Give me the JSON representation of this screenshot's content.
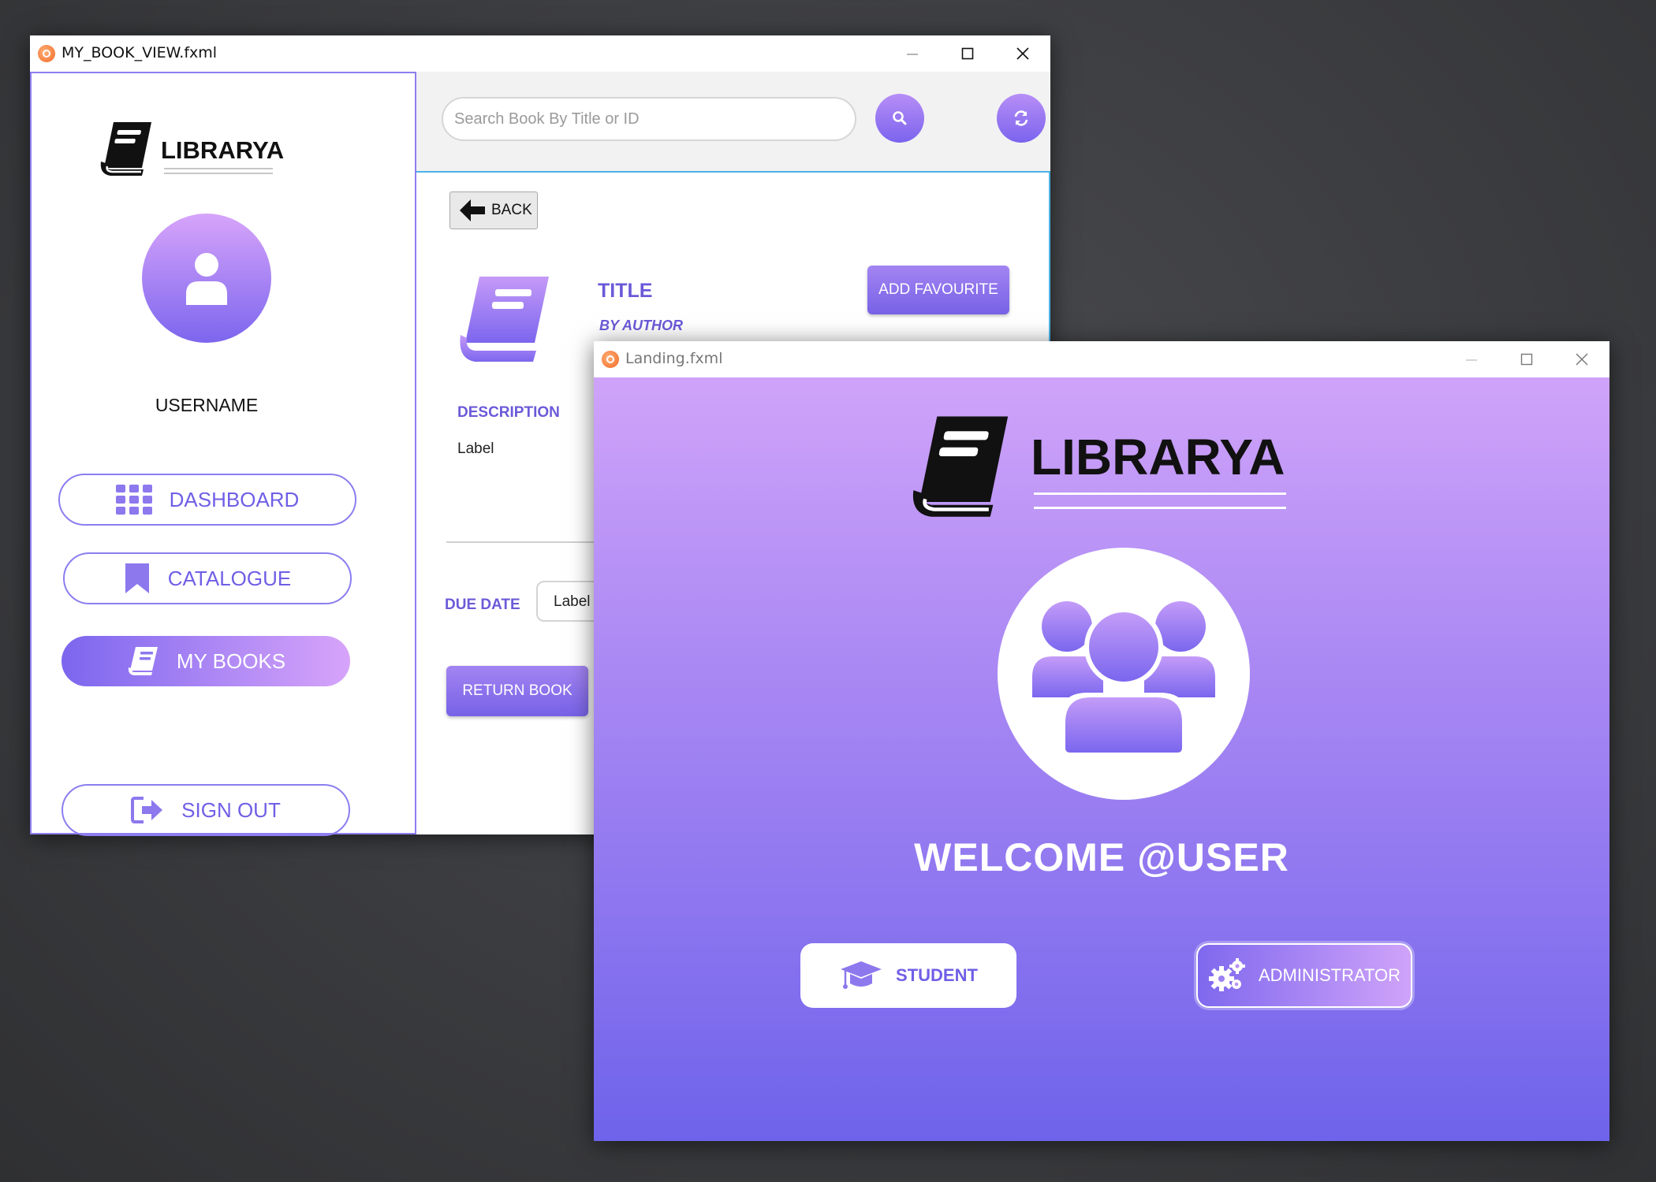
{
  "windows": {
    "book_view": {
      "title": "MY_BOOK_VIEW.fxml",
      "sidebar": {
        "brand": "LIBRARYA",
        "username": "USERNAME",
        "nav": {
          "dashboard": "DASHBOARD",
          "catalogue": "CATALOGUE",
          "my_books": "MY BOOKS",
          "sign_out": "SIGN OUT"
        }
      },
      "search": {
        "placeholder": "Search Book By Title or ID",
        "value": ""
      },
      "detail": {
        "back": "BACK",
        "title": "TITLE",
        "author": "BY AUTHOR",
        "add_favourite": "ADD FAVOURITE",
        "description_heading": "DESCRIPTION",
        "description_value": "Label",
        "due_date_label": "DUE DATE",
        "due_date_value": "Label",
        "return_book": "RETURN BOOK"
      }
    },
    "landing": {
      "title": "Landing.fxml",
      "brand": "LIBRARYA",
      "welcome": "WELCOME @USER",
      "student": "STUDENT",
      "administrator": "ADMINISTRATOR"
    }
  },
  "colors": {
    "accent": "#7b64ee",
    "accent_light": "#d7a4fa",
    "accent_text": "#6f5fe6",
    "frame_border": "#4cb3e6",
    "desktop": "#3b3c3f"
  },
  "icons": {
    "dashboard": "grid-icon",
    "catalogue": "bookmark-icon",
    "my_books": "book-icon",
    "sign_out": "sign-out-icon",
    "search": "search-icon",
    "refresh": "refresh-icon",
    "back": "arrow-left-icon",
    "rating": "star-icon",
    "student": "graduation-cap-icon",
    "administrator": "gears-icon",
    "users": "users-icon"
  }
}
